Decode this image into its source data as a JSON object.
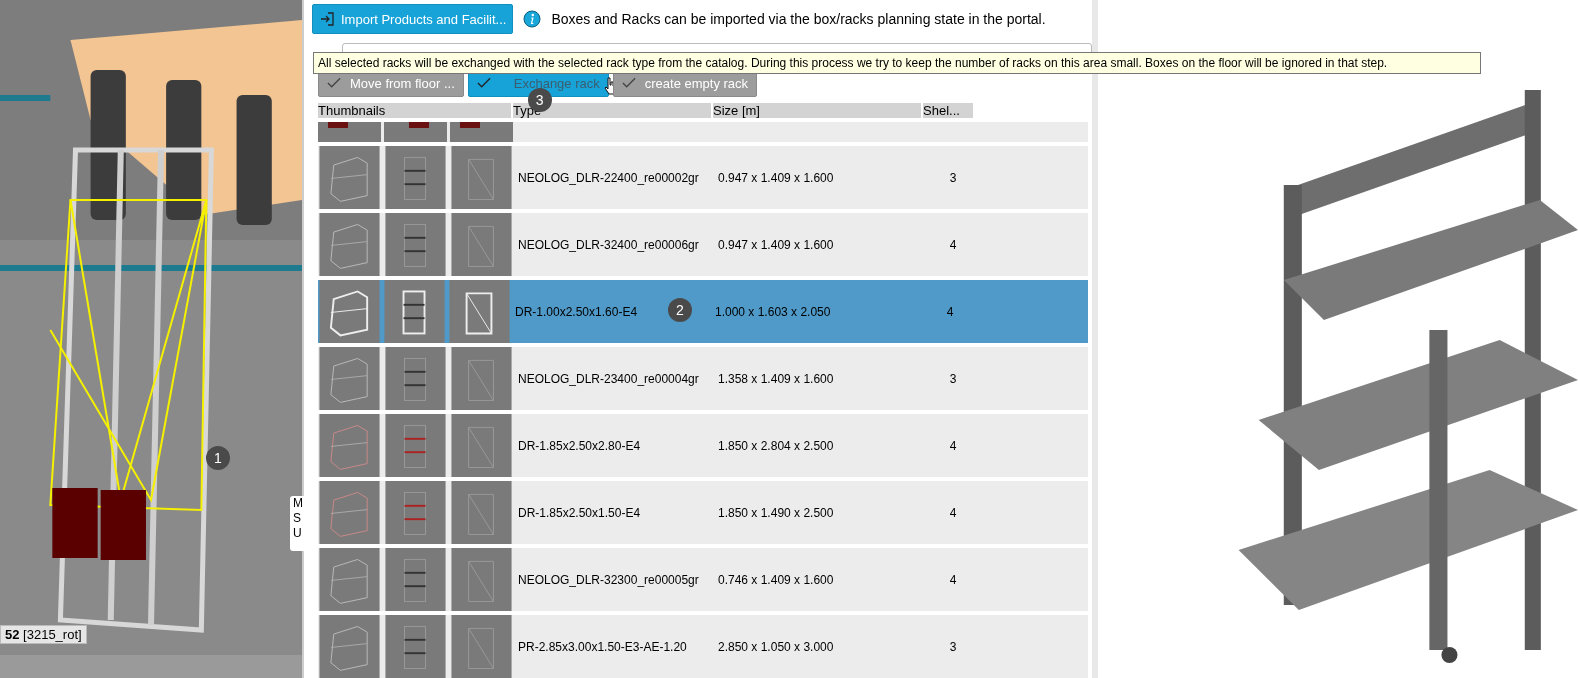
{
  "left_view": {
    "marker": "1",
    "object_label": "**52** [3215_rot]",
    "popup_lines": [
      "M",
      "S",
      "U"
    ]
  },
  "import_button": {
    "label": "Import Products and Facilit..."
  },
  "info_text": "Boxes and Racks can be imported via the box/racks planning state in the portal.",
  "tooltip": "All selected racks will be exchanged with the selected rack type from the catalog. During this process we try to keep the number of racks on this area small. Boxes on the floor will be ignored in that step.",
  "actions": [
    {
      "label": "Move from floor ...",
      "disabled": true
    },
    {
      "label": "Exchange rack",
      "disabled": false,
      "marker": "3"
    },
    {
      "label": "create empty rack",
      "disabled": true
    }
  ],
  "table": {
    "columns": [
      "Thumbnails",
      "Type",
      "Size [m]",
      "Shel..."
    ],
    "rows": [
      {
        "type": "NEOLOG_DLR-22400_re00002gr",
        "size": "0.947 x 1.409 x 1.600",
        "shelves": "3",
        "selected": false
      },
      {
        "type": "NEOLOG_DLR-32400_re00006gr",
        "size": "0.947 x 1.409 x 1.600",
        "shelves": "4",
        "selected": false
      },
      {
        "type": "DR-1.00x2.50x1.60-E4",
        "size": "1.000 x 1.603 x 2.050",
        "shelves": "4",
        "selected": true,
        "marker": "2"
      },
      {
        "type": "NEOLOG_DLR-23400_re00004gr",
        "size": "1.358 x 1.409 x 1.600",
        "shelves": "3",
        "selected": false
      },
      {
        "type": "DR-1.85x2.50x2.80-E4",
        "size": "1.850 x 2.804 x 2.500",
        "shelves": "4",
        "selected": false
      },
      {
        "type": "DR-1.85x2.50x1.50-E4",
        "size": "1.850 x 1.490 x 2.500",
        "shelves": "4",
        "selected": false
      },
      {
        "type": "NEOLOG_DLR-32300_re00005gr",
        "size": "0.746 x 1.409 x 1.600",
        "shelves": "4",
        "selected": false
      },
      {
        "type": "PR-2.85x3.00x1.50-E3-AE-1.20",
        "size": "2.850 x 1.050 x 3.000",
        "shelves": "3",
        "selected": false
      }
    ]
  }
}
